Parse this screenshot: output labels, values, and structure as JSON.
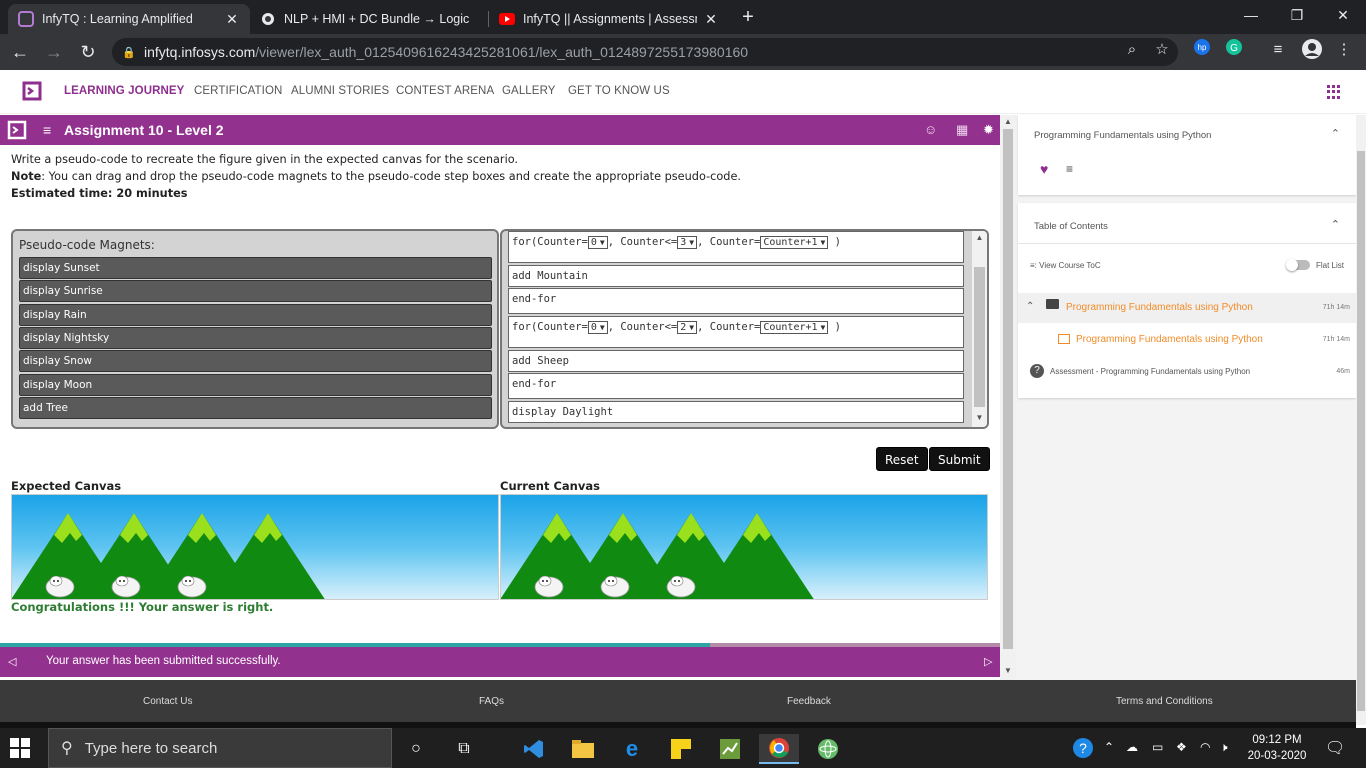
{
  "browser": {
    "tabs": [
      {
        "title": "InfyTQ : Learning Amplified",
        "active": true
      },
      {
        "title": "NLP + HMI + DC Bundle → Logic",
        "active": false
      },
      {
        "title": "InfyTQ || Assignments | Assessme",
        "active": false
      }
    ],
    "tab_close_glyph": "✕",
    "new_tab_glyph": "+",
    "url_host": "infytq.infosys.com",
    "url_path": "/viewer/lex_auth_01254096162434252810​61/lex_auth_0124897255173980160",
    "window_controls": [
      "—",
      "❐",
      "✕"
    ]
  },
  "site_nav": {
    "items": [
      "LEARNING JOURNEY",
      "CERTIFICATION",
      "ALUMNI STORIES",
      "CONTEST ARENA",
      "GALLERY",
      "GET TO KNOW US"
    ],
    "active_index": 0
  },
  "assignment": {
    "title": "Assignment 10 - Level 2",
    "instruction": "Write a pseudo-code to recreate the figure given in the expected canvas for the scenario.",
    "note_label": "Note",
    "note_text": ": You can drag and drop the pseudo-code magnets to the pseudo-code step boxes and create the appropriate pseudo-code.",
    "estimate": "Estimated time: 20 minutes",
    "magnets_header": "Pseudo-code Magnets:",
    "magnets": [
      "display Sunset",
      "display Sunrise",
      "display Rain",
      "display Nightsky",
      "display Snow",
      "display Moon",
      "add Tree"
    ],
    "steps": [
      {
        "type": "for",
        "start": "0",
        "limit": "3",
        "increment": "Counter+1"
      },
      {
        "type": "text",
        "text": "add Mountain"
      },
      {
        "type": "text",
        "text": "end-for"
      },
      {
        "type": "for",
        "start": "0",
        "limit": "2",
        "increment": "Counter+1"
      },
      {
        "type": "text",
        "text": "add Sheep"
      },
      {
        "type": "text",
        "text": "end-for"
      },
      {
        "type": "text",
        "text": "display Daylight"
      }
    ],
    "for_labels": {
      "prefix": "for(Counter=",
      "mid1": ", Counter<=",
      "mid2": ", Counter=",
      "suffix": " )"
    },
    "reset_label": "Reset",
    "submit_label": "Submit",
    "expected_canvas_label": "Expected Canvas",
    "current_canvas_label": "Current Canvas",
    "congrats": "Congratulations !!! Your answer is right.",
    "submitted_msg": "Your answer has been submitted successfully."
  },
  "side_panel": {
    "course_title": "Programming Fundamentals using Python",
    "toc_title": "Table of Contents",
    "view_toc": "View Course ToC",
    "flat_list": "Flat List",
    "toc_items": [
      {
        "title": "Programming Fundamentals using Python",
        "duration": "71h 14m",
        "icon": "folder-icon"
      },
      {
        "title": "Programming Fundamentals using Python",
        "duration": "71h 14m",
        "icon": "module-icon"
      },
      {
        "title": "Assessment - Programming Fundamentals using Python",
        "duration": "46m",
        "icon": "help-icon"
      }
    ]
  },
  "footer": {
    "links": [
      "Contact Us",
      "FAQs",
      "Feedback",
      "Terms and Conditions"
    ]
  },
  "taskbar": {
    "search_placeholder": "Type here to search",
    "time": "09:12 PM",
    "date": "20-03-2020"
  },
  "colors": {
    "brand_purple": "#93318f",
    "progress_teal": "#2fa4a4",
    "toc_orange": "#f28c28",
    "success_green": "#2e7d32"
  },
  "progress": {
    "fraction": 0.71
  }
}
